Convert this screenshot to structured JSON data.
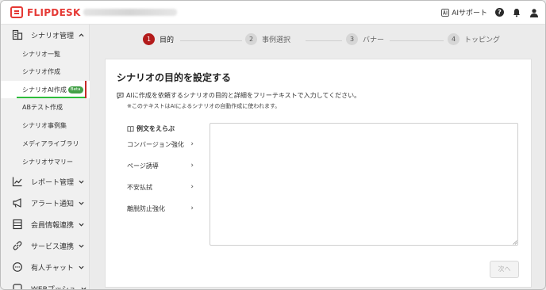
{
  "header": {
    "logo_text": "FLIPDESK",
    "ai_support_label": "AIサポート",
    "help_label": "?"
  },
  "sidebar": {
    "groups": [
      {
        "label": "シナリオ管理",
        "icon": "building-icon",
        "expanded": true
      },
      {
        "label": "レポート管理",
        "icon": "chart-line-icon"
      },
      {
        "label": "アラート通知",
        "icon": "megaphone-icon"
      },
      {
        "label": "会員情報連携",
        "icon": "table-icon"
      },
      {
        "label": "サービス連携",
        "icon": "link-icon"
      },
      {
        "label": "有人チャット",
        "icon": "chat-bubble-icon"
      },
      {
        "label": "WEBプッシュ",
        "icon": "push-icon"
      }
    ],
    "sub_items": [
      {
        "label": "シナリオ一覧"
      },
      {
        "label": "シナリオ作成"
      },
      {
        "label": "シナリオAI作成",
        "badge": "Beta",
        "active": true
      },
      {
        "label": "ABテスト作成"
      },
      {
        "label": "シナリオ事例集"
      },
      {
        "label": "メディアライブラリ"
      },
      {
        "label": "シナリオサマリー"
      }
    ]
  },
  "stepper": {
    "steps": [
      {
        "num": "1",
        "label": "目的",
        "active": true
      },
      {
        "num": "2",
        "label": "事例選択"
      },
      {
        "num": "3",
        "label": "バナー"
      },
      {
        "num": "4",
        "label": "トッピング"
      }
    ]
  },
  "main": {
    "title": "シナリオの目的を設定する",
    "description": "AIに作成を依頼するシナリオの目的と詳細をフリーテキストで入力してください。",
    "note": "※このテキストはAIによるシナリオの自動作成に使われます。",
    "examples_heading": "例文をえらぶ",
    "examples": [
      {
        "label": "コンバージョン強化"
      },
      {
        "label": "ページ誘導"
      },
      {
        "label": "不安払拭"
      },
      {
        "label": "離脱防止強化"
      }
    ],
    "textarea_value": "",
    "next_label": "次へ"
  },
  "colors": {
    "brand_red": "#e53935",
    "step_active": "#b31b1b",
    "beta_green": "#43a047"
  }
}
